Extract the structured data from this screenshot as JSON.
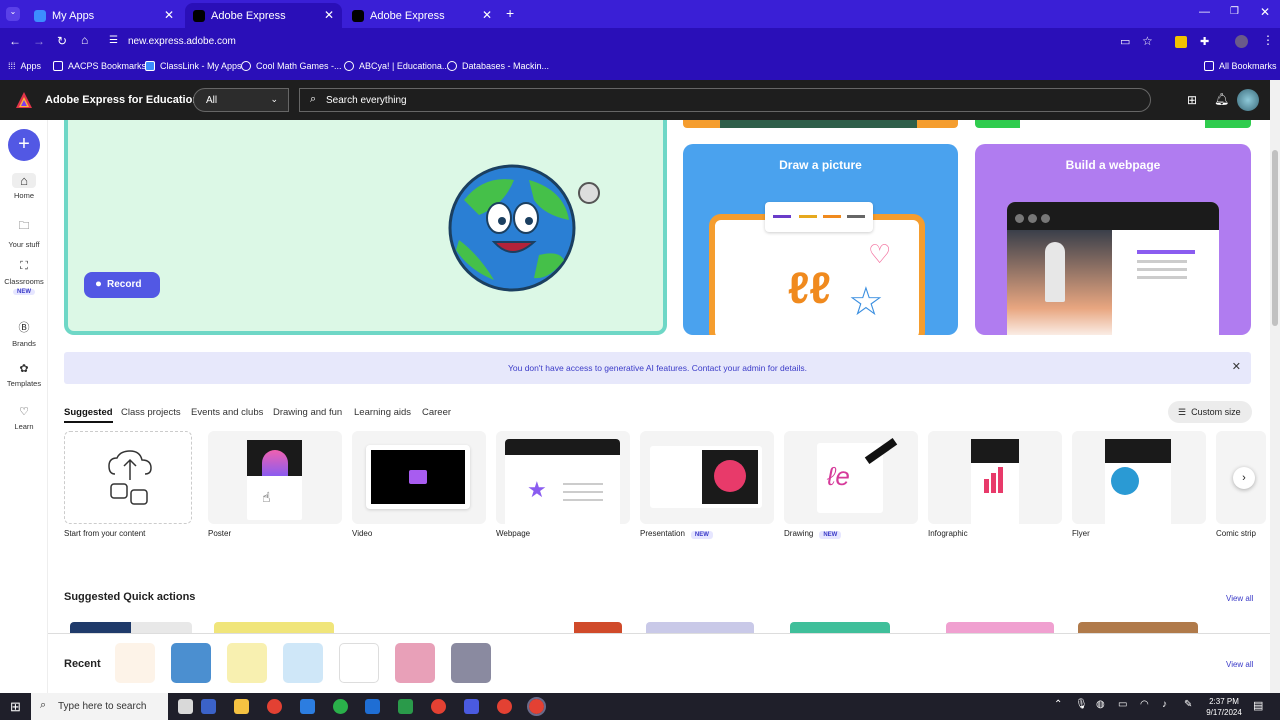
{
  "browser": {
    "tabs": [
      {
        "title": "My Apps"
      },
      {
        "title": "Adobe Express"
      },
      {
        "title": "Adobe Express"
      }
    ],
    "url": "new.express.adobe.com",
    "bookmarks": [
      "Apps",
      "AACPS Bookmarks",
      "ClassLink - My Apps",
      "Cool Math Games -...",
      "ABCya! | Educationa...",
      "Databases - Mackin..."
    ],
    "all_bookmarks": "All Bookmarks"
  },
  "app": {
    "name": "Adobe Express for Education",
    "filter_value": "All",
    "search_placeholder": "Search everything"
  },
  "rail": [
    {
      "label": "Home",
      "icon": "home-icon"
    },
    {
      "label": "Your stuff",
      "icon": "folder-icon"
    },
    {
      "label": "Classrooms",
      "icon": "classroom-icon",
      "badge": "NEW"
    },
    {
      "label": "Brands",
      "icon": "brand-icon"
    },
    {
      "label": "Templates",
      "icon": "templates-icon"
    },
    {
      "label": "Learn",
      "icon": "learn-icon"
    }
  ],
  "hero": {
    "record_label": "Record",
    "draw_title": "Draw a picture",
    "web_title": "Build a webpage"
  },
  "notice": "You don't have access to generative AI features. Contact your admin for details.",
  "category_tabs": [
    "Suggested",
    "Class projects",
    "Events and clubs",
    "Drawing and fun",
    "Learning aids",
    "Career"
  ],
  "custom_size": "Custom size",
  "templates": [
    {
      "label": "Start from your content"
    },
    {
      "label": "Poster"
    },
    {
      "label": "Video"
    },
    {
      "label": "Webpage"
    },
    {
      "label": "Presentation",
      "badge": "NEW"
    },
    {
      "label": "Drawing",
      "badge": "NEW"
    },
    {
      "label": "Infographic"
    },
    {
      "label": "Flyer"
    },
    {
      "label": "Comic strip"
    }
  ],
  "quick_actions": {
    "title": "Suggested Quick actions",
    "view_all": "View all"
  },
  "recent": {
    "title": "Recent",
    "view_all": "View all"
  },
  "taskbar": {
    "search_placeholder": "Type here to search",
    "time": "2:37 PM",
    "date": "9/17/2024"
  }
}
